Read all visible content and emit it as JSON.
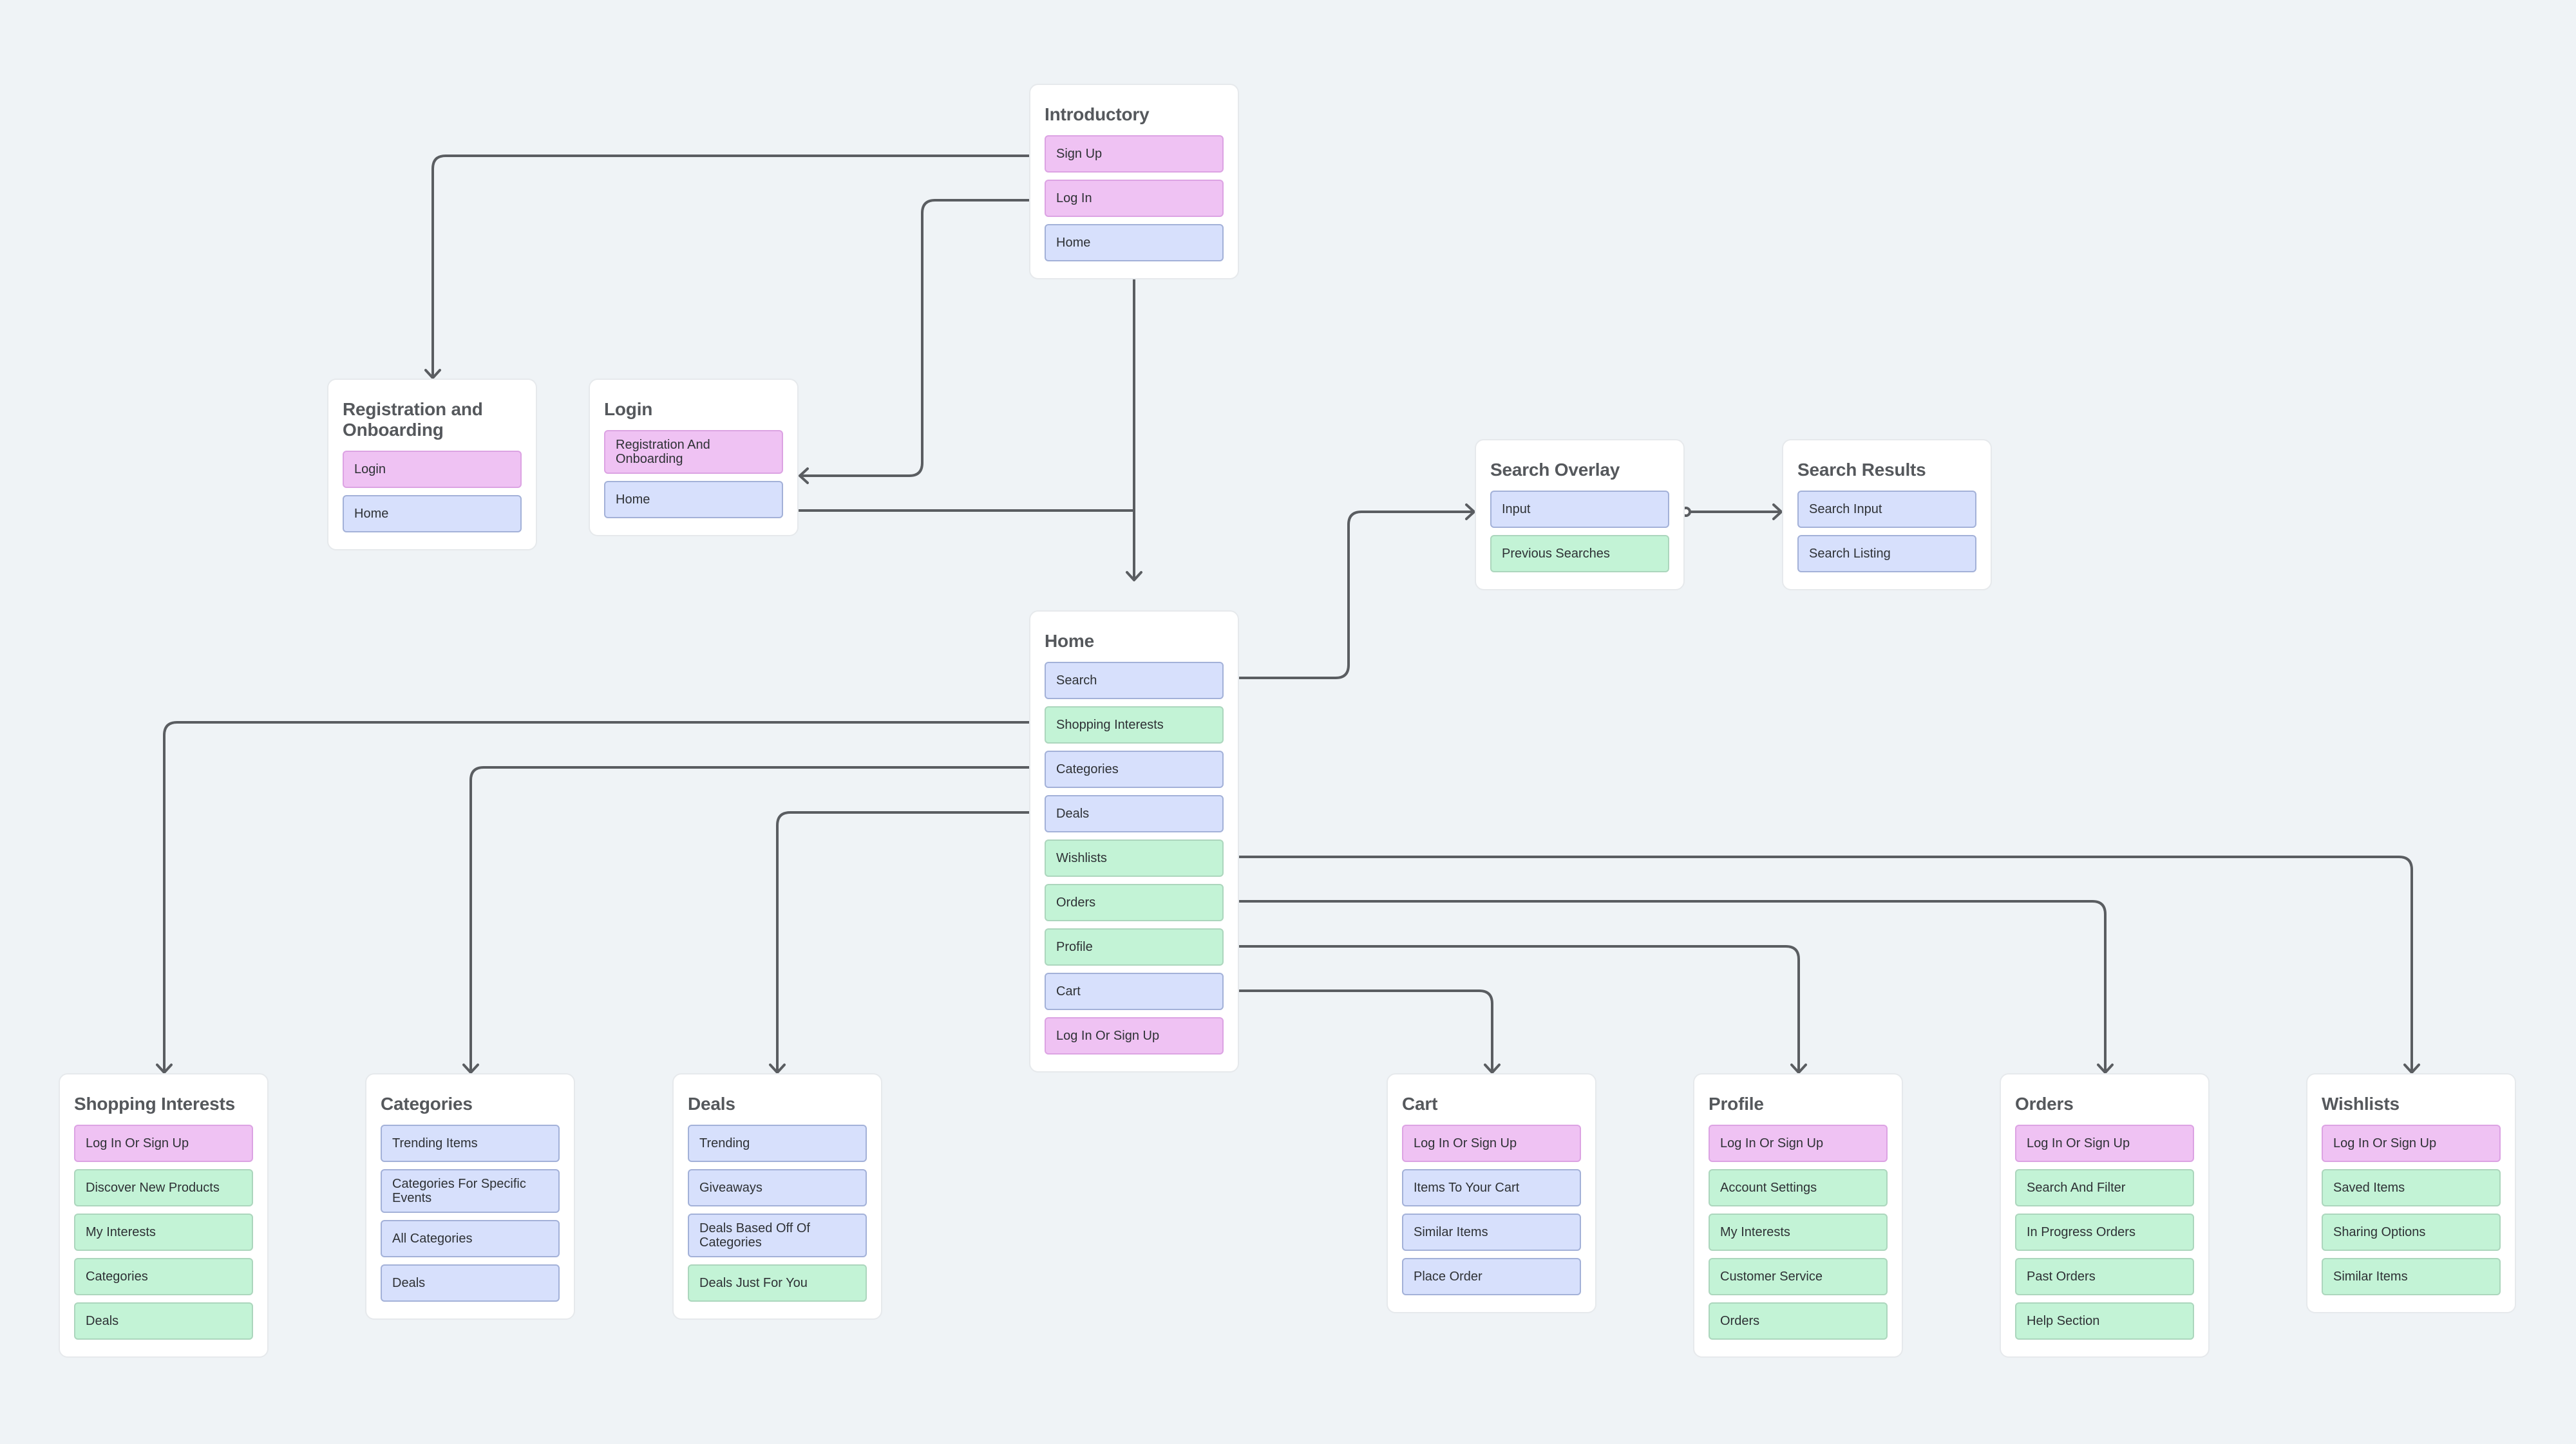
{
  "colors": {
    "background": "#eff3f6",
    "card": "#ffffff",
    "connector": "#5a5d61",
    "pink": "#efc2f3",
    "blue": "#d7e0fc",
    "green": "#c3f3d6"
  },
  "cards": {
    "introductory": {
      "title": "Introductory",
      "items": [
        {
          "label": "Sign Up",
          "color": "pink"
        },
        {
          "label": "Log In",
          "color": "pink"
        },
        {
          "label": "Home",
          "color": "blue"
        }
      ]
    },
    "registration": {
      "title": "Registration and Onboarding",
      "items": [
        {
          "label": "Login",
          "color": "pink"
        },
        {
          "label": "Home",
          "color": "blue"
        }
      ]
    },
    "login": {
      "title": "Login",
      "items": [
        {
          "label": "Registration And Onboarding",
          "color": "pink"
        },
        {
          "label": "Home",
          "color": "blue"
        }
      ]
    },
    "search_overlay": {
      "title": "Search Overlay",
      "items": [
        {
          "label": "Input",
          "color": "blue"
        },
        {
          "label": "Previous Searches",
          "color": "green"
        }
      ]
    },
    "search_results": {
      "title": "Search Results",
      "items": [
        {
          "label": "Search Input",
          "color": "blue"
        },
        {
          "label": "Search Listing",
          "color": "blue"
        }
      ]
    },
    "home": {
      "title": "Home",
      "items": [
        {
          "label": "Search",
          "color": "blue"
        },
        {
          "label": "Shopping Interests",
          "color": "green"
        },
        {
          "label": "Categories",
          "color": "blue"
        },
        {
          "label": "Deals",
          "color": "blue"
        },
        {
          "label": "Wishlists",
          "color": "green"
        },
        {
          "label": "Orders",
          "color": "green"
        },
        {
          "label": "Profile",
          "color": "green"
        },
        {
          "label": "Cart",
          "color": "blue"
        },
        {
          "label": "Log In Or Sign Up",
          "color": "pink"
        }
      ]
    },
    "shopping_interests": {
      "title": "Shopping Interests",
      "items": [
        {
          "label": "Log In Or Sign Up",
          "color": "pink"
        },
        {
          "label": "Discover New Products",
          "color": "green"
        },
        {
          "label": "My Interests",
          "color": "green"
        },
        {
          "label": "Categories",
          "color": "green"
        },
        {
          "label": "Deals",
          "color": "green"
        }
      ]
    },
    "categories": {
      "title": "Categories",
      "items": [
        {
          "label": "Trending Items",
          "color": "blue"
        },
        {
          "label": "Categories For Specific Events",
          "color": "blue"
        },
        {
          "label": "All Categories",
          "color": "blue"
        },
        {
          "label": "Deals",
          "color": "blue"
        }
      ]
    },
    "deals": {
      "title": "Deals",
      "items": [
        {
          "label": "Trending",
          "color": "blue"
        },
        {
          "label": "Giveaways",
          "color": "blue"
        },
        {
          "label": "Deals Based Off Of Categories",
          "color": "blue"
        },
        {
          "label": "Deals Just For You",
          "color": "green"
        }
      ]
    },
    "cart": {
      "title": "Cart",
      "items": [
        {
          "label": "Log In Or Sign Up",
          "color": "pink"
        },
        {
          "label": "Items To Your Cart",
          "color": "blue"
        },
        {
          "label": "Similar Items",
          "color": "blue"
        },
        {
          "label": "Place Order",
          "color": "blue"
        }
      ]
    },
    "profile": {
      "title": "Profile",
      "items": [
        {
          "label": "Log In Or Sign Up",
          "color": "pink"
        },
        {
          "label": "Account Settings",
          "color": "green"
        },
        {
          "label": "My Interests",
          "color": "green"
        },
        {
          "label": "Customer Service",
          "color": "green"
        },
        {
          "label": "Orders",
          "color": "green"
        }
      ]
    },
    "orders": {
      "title": "Orders",
      "items": [
        {
          "label": "Log In Or Sign Up",
          "color": "pink"
        },
        {
          "label": "Search And Filter",
          "color": "green"
        },
        {
          "label": "In Progress Orders",
          "color": "green"
        },
        {
          "label": "Past Orders",
          "color": "green"
        },
        {
          "label": "Help Section",
          "color": "green"
        }
      ]
    },
    "wishlists": {
      "title": "Wishlists",
      "items": [
        {
          "label": "Log In Or Sign Up",
          "color": "pink"
        },
        {
          "label": "Saved Items",
          "color": "green"
        },
        {
          "label": "Sharing Options",
          "color": "green"
        },
        {
          "label": "Similar Items",
          "color": "green"
        }
      ]
    }
  },
  "links": [
    {
      "from": "introductory.Sign Up",
      "to": "registration"
    },
    {
      "from": "introductory.Log In",
      "to": "login"
    },
    {
      "from": "introductory.Home",
      "to": "home"
    },
    {
      "from": "login.Home",
      "to": "home"
    },
    {
      "from": "home.Search",
      "to": "search_overlay"
    },
    {
      "from": "search_overlay.Input",
      "to": "search_results"
    },
    {
      "from": "home.Shopping Interests",
      "to": "shopping_interests"
    },
    {
      "from": "home.Categories",
      "to": "categories"
    },
    {
      "from": "home.Deals",
      "to": "deals"
    },
    {
      "from": "home.Wishlists",
      "to": "wishlists"
    },
    {
      "from": "home.Orders",
      "to": "orders"
    },
    {
      "from": "home.Profile",
      "to": "profile"
    },
    {
      "from": "home.Cart",
      "to": "cart"
    }
  ]
}
